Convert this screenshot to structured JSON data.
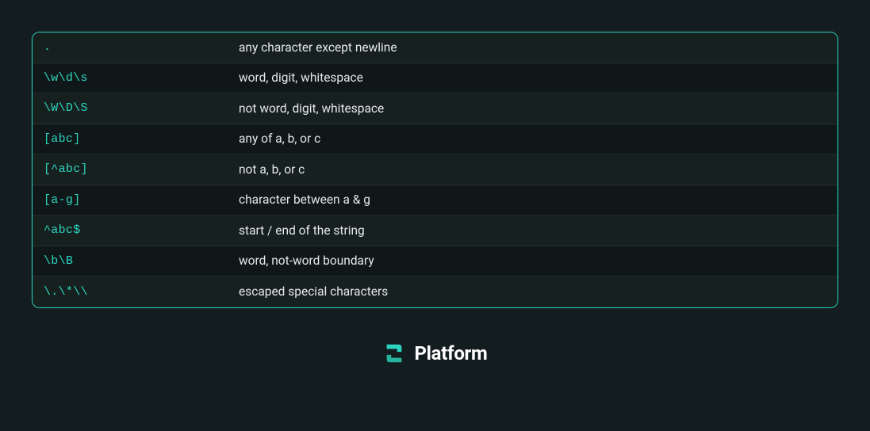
{
  "table": {
    "rows": [
      {
        "pattern": ".",
        "description": "any character except newline"
      },
      {
        "pattern": "\\w\\d\\s",
        "description": "word, digit, whitespace"
      },
      {
        "pattern": "\\W\\D\\S",
        "description": "not word, digit, whitespace"
      },
      {
        "pattern": "[abc]",
        "description": "any of a, b, or c"
      },
      {
        "pattern": "[^abc]",
        "description": "not a, b, or c"
      },
      {
        "pattern": "[a-g]",
        "description": "character between a & g"
      },
      {
        "pattern": "^abc$",
        "description": "start / end of the string"
      },
      {
        "pattern": "\\b\\B",
        "description": "word, not-word boundary"
      },
      {
        "pattern": "\\.\\*\\\\",
        "description": "escaped special characters"
      }
    ]
  },
  "footer": {
    "brand": "Platform"
  }
}
